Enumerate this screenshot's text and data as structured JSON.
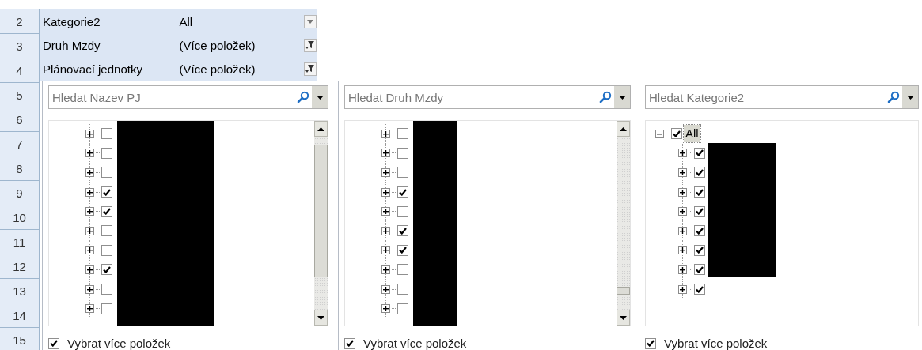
{
  "row_headers": [
    "2",
    "3",
    "4",
    "5",
    "6",
    "7",
    "8",
    "9",
    "10",
    "11",
    "12",
    "13",
    "14",
    "15"
  ],
  "report_filters": [
    {
      "field": "Kategorie2",
      "value": "All",
      "filtered": false
    },
    {
      "field": "Druh Mzdy",
      "value": "(Více položek)",
      "filtered": true
    },
    {
      "field": "Plánovací jednotky",
      "value": "(Více položek)",
      "filtered": true
    }
  ],
  "filter_panels": [
    {
      "search_placeholder": "Hledat Nazev PJ",
      "scrollable": true,
      "items": [
        {
          "checked": false,
          "expanded": false
        },
        {
          "checked": false,
          "expanded": false
        },
        {
          "checked": false,
          "expanded": false
        },
        {
          "checked": true,
          "expanded": false
        },
        {
          "checked": true,
          "expanded": false
        },
        {
          "checked": false,
          "expanded": false
        },
        {
          "checked": false,
          "expanded": false
        },
        {
          "checked": true,
          "expanded": false
        },
        {
          "checked": false,
          "expanded": false
        },
        {
          "checked": false,
          "expanded": false
        }
      ],
      "multi_select": {
        "label": "Vybrat více položek",
        "checked": true
      }
    },
    {
      "search_placeholder": "Hledat Druh Mzdy",
      "scrollable": true,
      "items": [
        {
          "checked": false,
          "expanded": false
        },
        {
          "checked": false,
          "expanded": false
        },
        {
          "checked": false,
          "expanded": false
        },
        {
          "checked": true,
          "expanded": false
        },
        {
          "checked": false,
          "expanded": false
        },
        {
          "checked": true,
          "expanded": false
        },
        {
          "checked": true,
          "expanded": false
        },
        {
          "checked": false,
          "expanded": false
        },
        {
          "checked": false,
          "expanded": false
        },
        {
          "checked": false,
          "expanded": false
        }
      ],
      "multi_select": {
        "label": "Vybrat více položek",
        "checked": true
      }
    },
    {
      "search_placeholder": "Hledat Kategorie2",
      "scrollable": false,
      "items": [
        {
          "label": "All",
          "checked": true,
          "expanded": true,
          "selected": true,
          "children": [
            {
              "checked": true,
              "expanded": false
            },
            {
              "checked": true,
              "expanded": false
            },
            {
              "checked": true,
              "expanded": false
            },
            {
              "checked": true,
              "expanded": false
            },
            {
              "checked": true,
              "expanded": false
            },
            {
              "checked": true,
              "expanded": false
            },
            {
              "checked": true,
              "expanded": false
            },
            {
              "checked": true,
              "expanded": false
            }
          ]
        }
      ],
      "multi_select": {
        "label": "Vybrat více položek",
        "checked": true
      }
    }
  ]
}
